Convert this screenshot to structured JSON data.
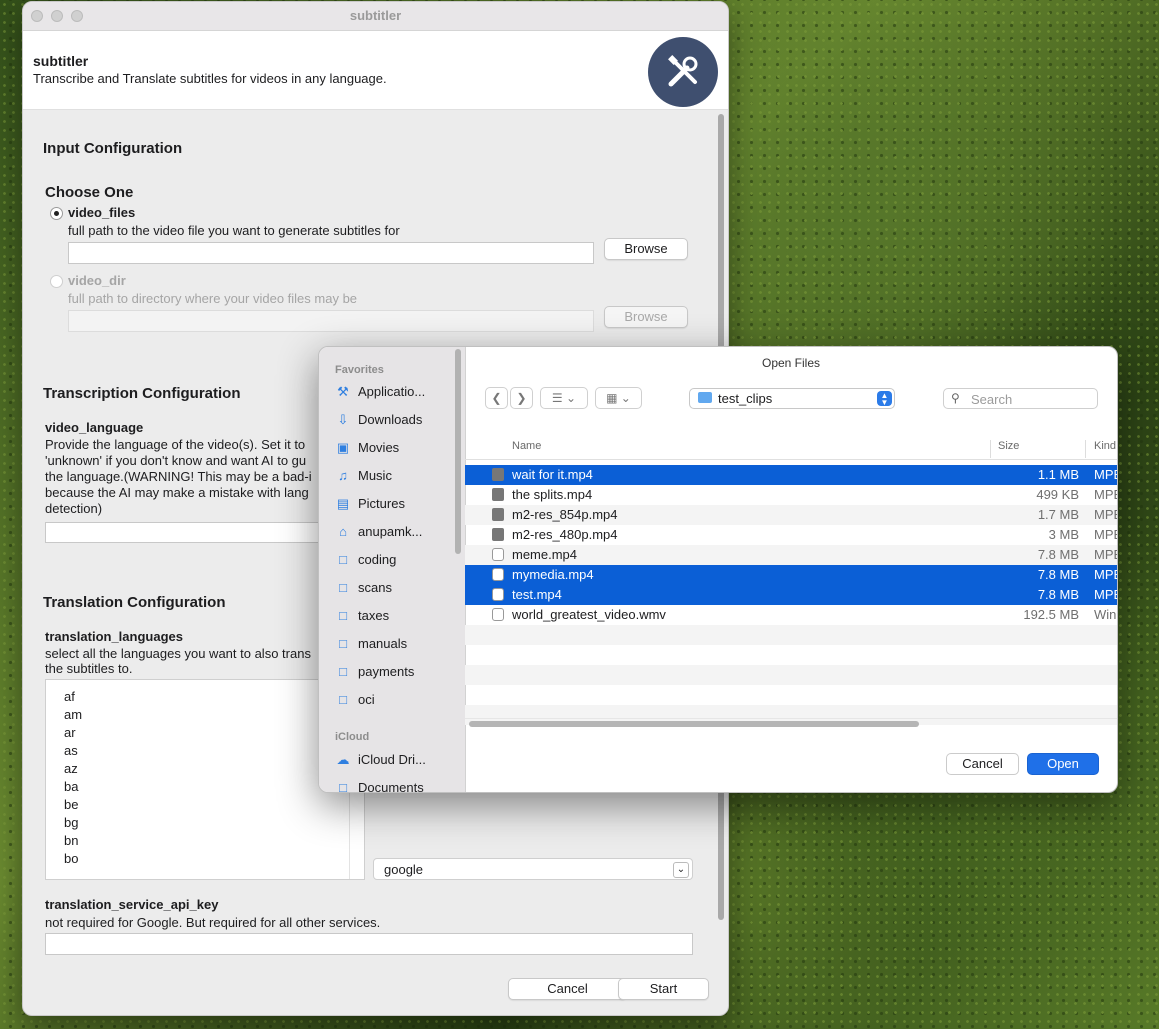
{
  "window": {
    "title": "subtitler",
    "app_name": "subtitler",
    "app_description": "Transcribe and Translate subtitles for videos in any language."
  },
  "input_config": {
    "section_title": "Input Configuration",
    "choose_label": "Choose One",
    "video_files": {
      "label": "video_files",
      "help": "full path to the video file you want to generate subtitles for",
      "value": "",
      "browse_label": "Browse",
      "selected": true
    },
    "video_dir": {
      "label": "video_dir",
      "help": "full path to directory where your video files may be",
      "value": "",
      "browse_label": "Browse",
      "selected": false
    }
  },
  "transcription_config": {
    "section_title": "Transcription Configuration",
    "video_language_label": "video_language",
    "video_language_help_lines": [
      "Provide the language of the video(s). Set it to",
      "'unknown' if you don't know and want AI to gu",
      "the language.(WARNING! This may be a bad-i",
      "because the AI may make a mistake with lang",
      "detection)"
    ],
    "video_language_value": ""
  },
  "translation_config": {
    "section_title": "Translation Configuration",
    "languages_label": "translation_languages",
    "languages_help_lines": [
      "select all the languages you want to also trans",
      "the subtitles to."
    ],
    "languages": [
      "af",
      "am",
      "ar",
      "as",
      "az",
      "ba",
      "be",
      "bg",
      "bn",
      "bo"
    ],
    "service_value": "google",
    "api_key_label": "translation_service_api_key",
    "api_key_help": "not required for Google. But required for all other services.",
    "api_key_value": ""
  },
  "footer": {
    "cancel_label": "Cancel",
    "start_label": "Start"
  },
  "open_dialog": {
    "title": "Open Files",
    "favorites_label": "Favorites",
    "icloud_label": "iCloud",
    "favorites": [
      {
        "label": "Applicatio...",
        "icon": "applications-icon"
      },
      {
        "label": "Downloads",
        "icon": "downloads-icon"
      },
      {
        "label": "Movies",
        "icon": "movies-icon"
      },
      {
        "label": "Music",
        "icon": "music-icon"
      },
      {
        "label": "Pictures",
        "icon": "pictures-icon"
      },
      {
        "label": "anupamk...",
        "icon": "home-icon"
      },
      {
        "label": "coding",
        "icon": "folder-icon"
      },
      {
        "label": "scans",
        "icon": "folder-icon"
      },
      {
        "label": "taxes",
        "icon": "folder-icon"
      },
      {
        "label": "manuals",
        "icon": "folder-icon"
      },
      {
        "label": "payments",
        "icon": "folder-icon"
      },
      {
        "label": "oci",
        "icon": "folder-icon"
      }
    ],
    "icloud": [
      {
        "label": "iCloud Dri...",
        "icon": "icloud-icon"
      },
      {
        "label": "Documents",
        "icon": "document-icon"
      }
    ],
    "current_folder": "test_clips",
    "search_placeholder": "Search",
    "columns": {
      "name": "Name",
      "size": "Size",
      "kind": "Kind"
    },
    "files": [
      {
        "name": "wait for it.mp4",
        "size": "1.1 MB",
        "kind": "MPE",
        "selected": true
      },
      {
        "name": "the splits.mp4",
        "size": "499 KB",
        "kind": "MPE",
        "selected": false
      },
      {
        "name": "m2-res_854p.mp4",
        "size": "1.7 MB",
        "kind": "MPE",
        "selected": false
      },
      {
        "name": "m2-res_480p.mp4",
        "size": "3 MB",
        "kind": "MPE",
        "selected": false
      },
      {
        "name": "meme.mp4",
        "size": "7.8 MB",
        "kind": "MPE",
        "selected": false
      },
      {
        "name": "mymedia.mp4",
        "size": "7.8 MB",
        "kind": "MPE",
        "selected": true
      },
      {
        "name": "test.mp4",
        "size": "7.8 MB",
        "kind": "MPE",
        "selected": true
      },
      {
        "name": "world_greatest_video.wmv",
        "size": "192.5 MB",
        "kind": "Win",
        "selected": false
      }
    ],
    "cancel_label": "Cancel",
    "open_label": "Open",
    "accent_color": "#0b5fd6"
  }
}
